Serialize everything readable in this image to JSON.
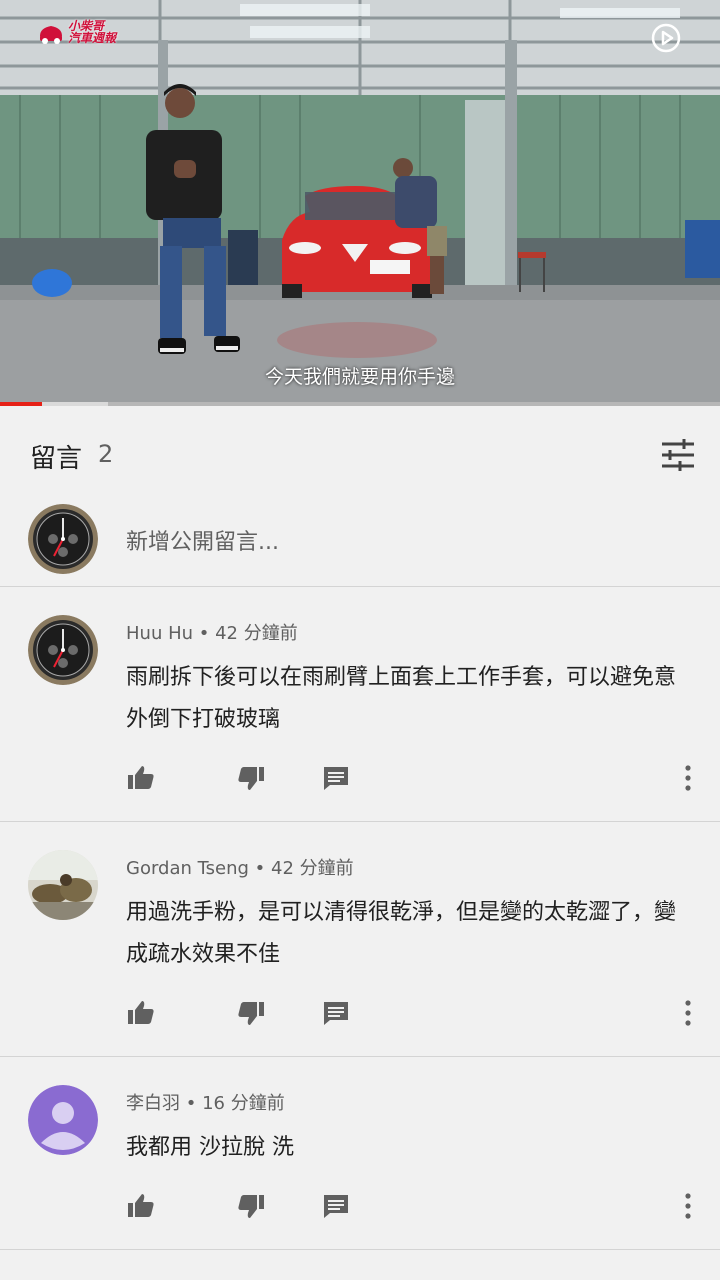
{
  "video": {
    "brand_text_line1": "小柴哥",
    "brand_text_line2": "汽車週報",
    "subtitle": "今天我們就要用你手邊",
    "progress_played_fraction": 0.058,
    "progress_buffered_fraction": 0.15
  },
  "comments_header": {
    "title": "留言",
    "count": "2"
  },
  "add_comment": {
    "placeholder": "新增公開留言..."
  },
  "comments": [
    {
      "author": "Huu Hu",
      "time": "42 分鐘前",
      "text": "雨刷拆下後可以在雨刷臂上面套上工作手套，可以避免意外倒下打破玻璃",
      "avatar": "watch-avatar"
    },
    {
      "author": "Gordan Tseng",
      "time": "42 分鐘前",
      "text": "用過洗手粉，是可以清得很乾淨，但是變的太乾澀了，變成疏水效果不佳",
      "avatar": "photo-avatar"
    },
    {
      "author": "李白羽",
      "time": "16 分鐘前",
      "text": "我都用 沙拉脫 洗",
      "avatar": "default-user-avatar"
    }
  ],
  "colors": {
    "accent_red": "#e62117",
    "background": "#f1f1f1",
    "secondary_text": "#606060",
    "default_avatar": "#8a6bd1"
  }
}
